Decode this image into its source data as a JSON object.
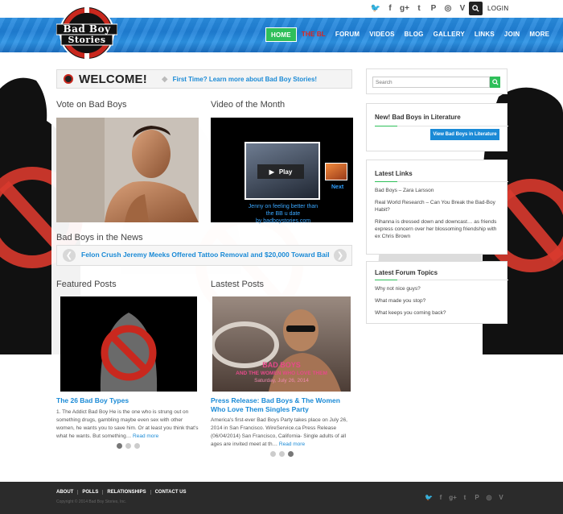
{
  "topbar": {
    "social_icons": [
      "twitter-icon",
      "facebook-icon",
      "google-plus-icon",
      "tumblr-icon",
      "pinterest-icon",
      "instagram-icon",
      "vimeo-icon"
    ],
    "social_glyphs": [
      "🐦",
      "f",
      "g+",
      "t",
      "P",
      "◎",
      "V"
    ],
    "login_label": "LOGIN"
  },
  "logo": {
    "line1": "Bad Boy",
    "line2": "Stories"
  },
  "nav": {
    "items": [
      "HOME",
      "THE BL",
      "FORUM",
      "VIDEOS",
      "BLOG",
      "GALLERY",
      "LINKS",
      "JOIN",
      "MORE"
    ],
    "active_index": 0
  },
  "welcome": {
    "title": "WELCOME!",
    "separator": "◆",
    "link": "First Time? Learn more about Bad Boy Stories!"
  },
  "sections": {
    "vote": "Vote on Bad Boys",
    "video": "Video of the Month",
    "news": "Bad Boys in the News",
    "featured": "Featured Posts",
    "latest": "Lastest Posts"
  },
  "video": {
    "play_label": "Play",
    "next_label": "Next",
    "caption_line1": "Jenny on feeling better than",
    "caption_line2": "the BB u date",
    "caption_line3": "by badboystories.com"
  },
  "news": {
    "headline": "Felon Crush Jeremy Meeks Offered Tattoo Removal and $20,000 Toward Bail",
    "prev_glyph": "❮",
    "next_glyph": "❯"
  },
  "featured_post": {
    "title": "The 26 Bad Boy Types",
    "body": "1. The Addict Bad Boy He is the one who is strung out on something drugs, gambling maybe even sex with other women, he wants you to save him. Or at least you think that's what he wants. But something…",
    "more": "Read more",
    "dots_active": 0
  },
  "latest_post": {
    "title": "Press Release: Bad Boys & The Women Who Love Them Singles Party",
    "body": "America's first-ever Bad Boys Party takes place on July 26, 2014 in San Francisco. WireService.ca Press Release (06/04/2014) San Francisco, California- Single adults of all ages are invited meet at th…",
    "more": "Read more",
    "poster_line1": "BAD BOYS",
    "poster_line2": "AND THE WOMEN WHO LOVE THEM",
    "poster_line3": "Saturday, July 26, 2014",
    "dots_active": 2
  },
  "sidebar": {
    "search_placeholder": "Search",
    "literature_title": "New! Bad Boys in Literature",
    "literature_button": "View Bad Boys in Literature",
    "links_title": "Latest Links",
    "links": [
      "Bad Boys – Zara Larsson",
      "Real World Research – Can You Break the Bad-Boy Habit?",
      "Rihanna is dressed down and downcast… as friends express concern over her blossoming friendship with ex Chris Brown"
    ],
    "forum_title": "Latest Forum Topics",
    "forum": [
      "Why not nice guys?",
      "What made you stop?",
      "What keeps you coming back?"
    ]
  },
  "footer": {
    "links": [
      "ABOUT",
      "POLLS",
      "RELATIONSHIPS",
      "CONTACT US"
    ],
    "copyright": "Copyright © 2014 Bad Boy Stories, Inc."
  },
  "colors": {
    "accent_blue": "#1a8ad6",
    "accent_green": "#2fbf5a",
    "brand_red": "#c9281e",
    "header_blue": "#1f7fd6",
    "footer_dark": "#2b2b2b"
  }
}
